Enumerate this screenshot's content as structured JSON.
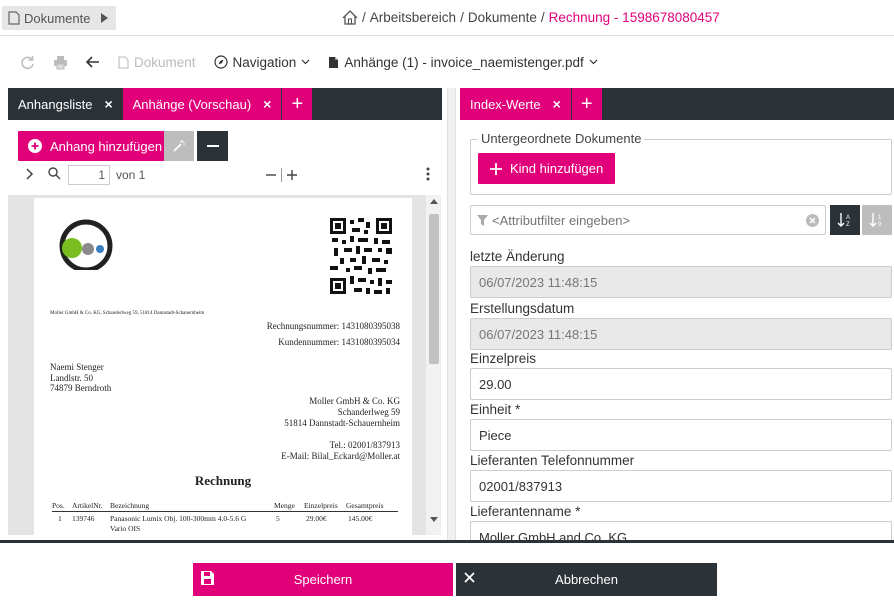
{
  "topbar": {
    "crumb_button": "Dokumente",
    "breadcrumb": {
      "sep1": "/",
      "item1": "Arbeitsbereich",
      "sep2": "/",
      "item2": "Dokumente",
      "sep3": "/",
      "current": "Rechnung - 1598678080457"
    }
  },
  "toolbar": {
    "document_label": "Dokument",
    "navigation_label": "Navigation",
    "attachments_label": "Anhänge (1) - invoice_naemistenger.pdf"
  },
  "left_panel": {
    "tabs": [
      {
        "label": "Anhangsliste",
        "close": "×"
      },
      {
        "label": "Anhänge (Vorschau)",
        "close": "×"
      }
    ],
    "add_button": "Anhang hinzufügen",
    "pager": {
      "page": "1",
      "of_label": "von 1"
    }
  },
  "pdf": {
    "sender_line": "Moller GmbH & Co. KG, Schanderlweg 59, 51814 Dannstadt-Schauernheim",
    "invoice_number": "Rechnungsnummer: 1431080395038",
    "customer_number": "Kundennummer: 1431080395034",
    "recipient": [
      "Naemi Stenger",
      "Landlstr. 50",
      "74879 Berndroth"
    ],
    "company": [
      "Moller GmbH & Co. KG",
      "Schanderlweg 59",
      "51814 Dannstadt-Schauernheim"
    ],
    "contact": [
      "Tel.: 02001/837913",
      "E-Mail: Bilal_Eckard@Moller.at"
    ],
    "heading": "Rechnung",
    "table_headers": [
      "Pos.",
      "ArtikelNr.",
      "Bezeichnung",
      "Menge",
      "Einzelpreis",
      "Gesamtpreis"
    ],
    "table_row": [
      "1",
      "139746",
      "Panasonic Lumix Obj. 100-300mm 4.0-5.6 G",
      "5",
      "29.00€",
      "145.00€"
    ],
    "table_row_cont": "Vario OIS"
  },
  "right_panel": {
    "tabs": [
      {
        "label": "Index-Werte",
        "close": "×"
      }
    ],
    "subdocs_legend": "Untergeordnete Dokumente",
    "add_child_button": "Kind hinzufügen",
    "filter_placeholder": "<Attributfilter eingeben>",
    "fields": [
      {
        "label": "letzte Änderung",
        "value": "06/07/2023 11:48:15"
      },
      {
        "label": "Erstellungsdatum",
        "value": "06/07/2023 11:48:15"
      },
      {
        "label": "Einzelpreis",
        "value": "29.00"
      },
      {
        "label": "Einheit *",
        "value": "Piece"
      },
      {
        "label": "Lieferanten Telefonnummer",
        "value": "02001/837913"
      },
      {
        "label": "Lieferantenname *",
        "value": "Moller GmbH and Co. KG"
      }
    ]
  },
  "footer": {
    "save_label": "Speichern",
    "cancel_label": "Abbrechen"
  },
  "colors": {
    "accent": "#e2007a",
    "dark": "#2b3238"
  }
}
